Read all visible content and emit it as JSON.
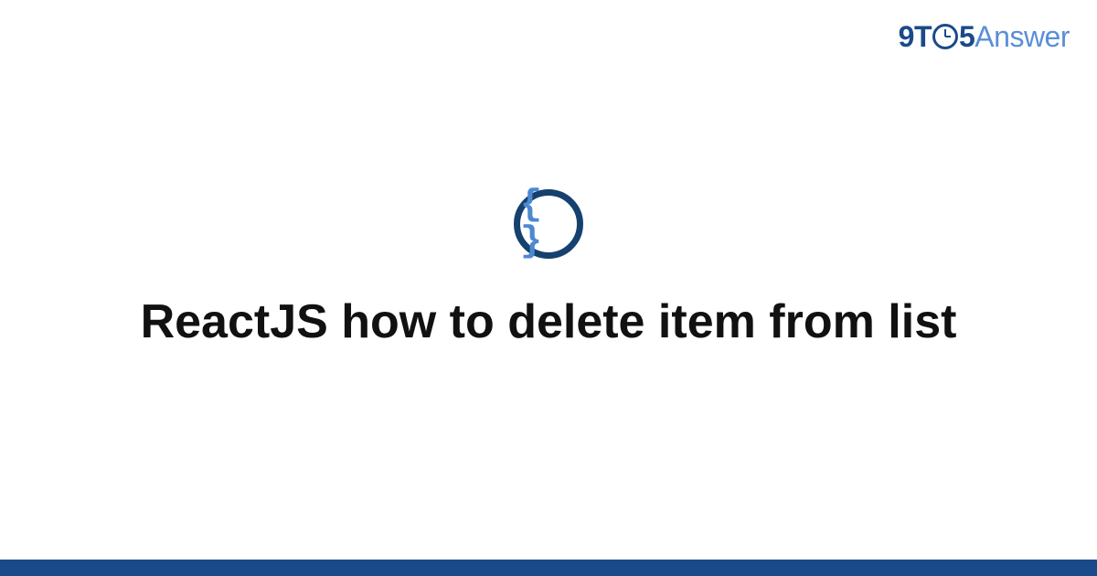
{
  "brand": {
    "part1": "9T",
    "part2": "5",
    "part3": "Answer"
  },
  "category_icon": {
    "glyph": "{ }",
    "semantic": "code-braces"
  },
  "title": "ReactJS how to delete item from list",
  "colors": {
    "brand_dark": "#1b4a8a",
    "brand_light": "#5a8fd6",
    "icon_ring": "#16416f",
    "icon_glyph": "#4d89d0",
    "text": "#111111"
  }
}
